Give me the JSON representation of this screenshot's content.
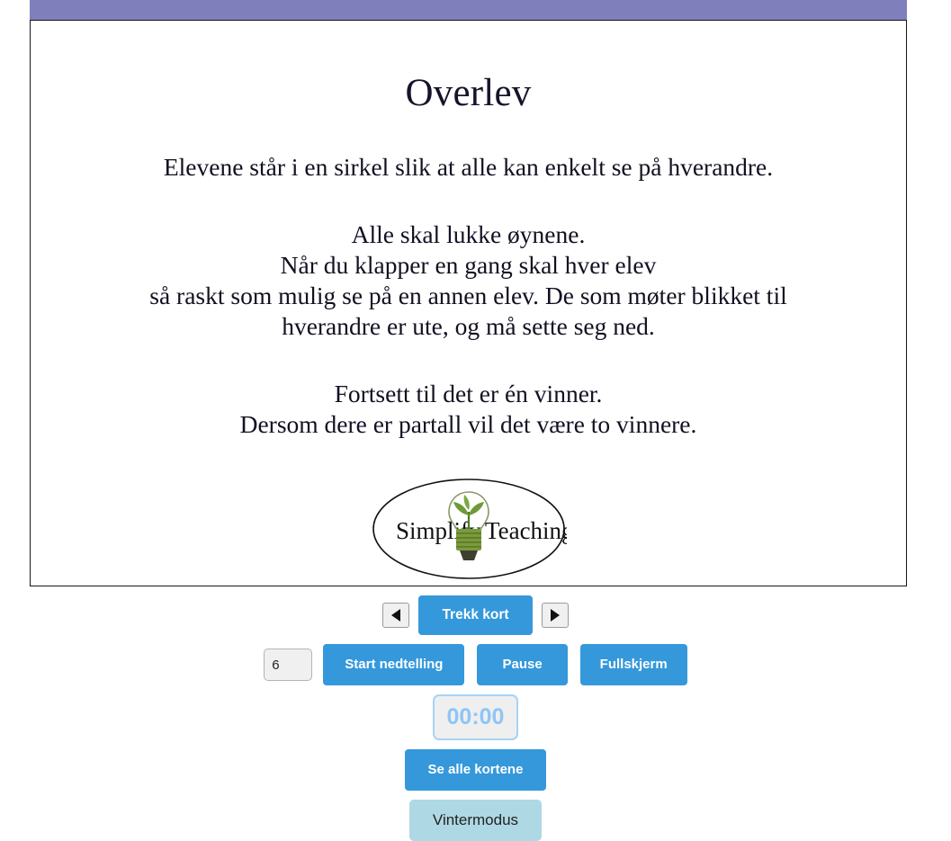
{
  "card": {
    "accent_color": "#7f7fbb",
    "title": "Overlev",
    "paragraphs": {
      "intro": "Elevene står i en sirkel slik at alle kan enkelt se på hverandre.",
      "rules_line1": "Alle skal lukke øynene.",
      "rules_line2": "Når du klapper en gang skal hver elev",
      "rules_line3": "så raskt som mulig se på en annen elev. De som møter blikket til",
      "rules_line4": "hverandre er ute, og må sette seg ned.",
      "win_line1": "Fortsett til det er én vinner.",
      "win_line2": "Dersom dere er partall vil det være to vinnere."
    },
    "logo": {
      "text_left": "Simplify",
      "text_right": "Teaching",
      "icon": "lightbulb-sprout-icon",
      "bulb_color": "#7a9a3c",
      "leaf_color": "#6f9a38"
    }
  },
  "controls": {
    "prev_icon": "triangle-left-icon",
    "next_icon": "triangle-right-icon",
    "draw_card_label": "Trekk kort",
    "countdown_value": "6",
    "countdown_placeholder": "",
    "start_countdown_label": "Start nedtelling",
    "pause_label": "Pause",
    "fullscreen_label": "Fullskjerm",
    "timer_value": "00:00",
    "see_all_cards_label": "Se alle kortene",
    "winter_mode_label": "Vintermodus",
    "accent_blue": "#3498db",
    "winter_blue": "#aed8e4",
    "timer_border": "#a8d3f7",
    "timer_text": "#8fc5f5"
  }
}
